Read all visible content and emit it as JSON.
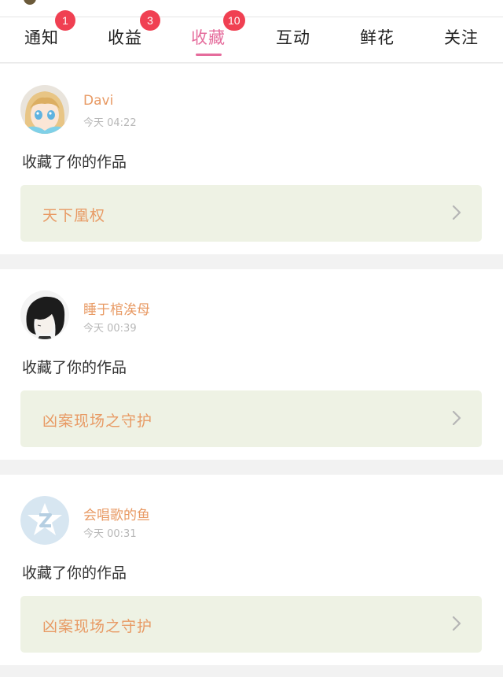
{
  "tabs": [
    {
      "label": "通知",
      "badge": "1"
    },
    {
      "label": "收益",
      "badge": "3"
    },
    {
      "label": "收藏",
      "badge": "10",
      "active": true
    },
    {
      "label": "互动"
    },
    {
      "label": "鲜花"
    },
    {
      "label": "关注"
    }
  ],
  "colors": {
    "accent": "#e56c9c",
    "badge": "#f04052",
    "name_and_title": "#e89a64",
    "work_box_bg": "#eef2e4"
  },
  "feed": [
    {
      "username": "Davi",
      "time": "今天 04:22",
      "action": "收藏了你的作品",
      "work_title": "天下凰权",
      "avatar_icon": "anime-girl-avatar-icon",
      "chevron_icon": "chevron-right-icon"
    },
    {
      "username": "睡于棺涘母",
      "time": "今天 00:39",
      "action": "收藏了你的作品",
      "work_title": "凶案现场之守护",
      "avatar_icon": "black-hair-avatar-icon",
      "chevron_icon": "chevron-right-icon"
    },
    {
      "username": "会唱歌的鱼",
      "time": "今天 00:31",
      "action": "收藏了你的作品",
      "work_title": "凶案现场之守护",
      "avatar_icon": "default-star-avatar-icon",
      "chevron_icon": "chevron-right-icon"
    }
  ]
}
